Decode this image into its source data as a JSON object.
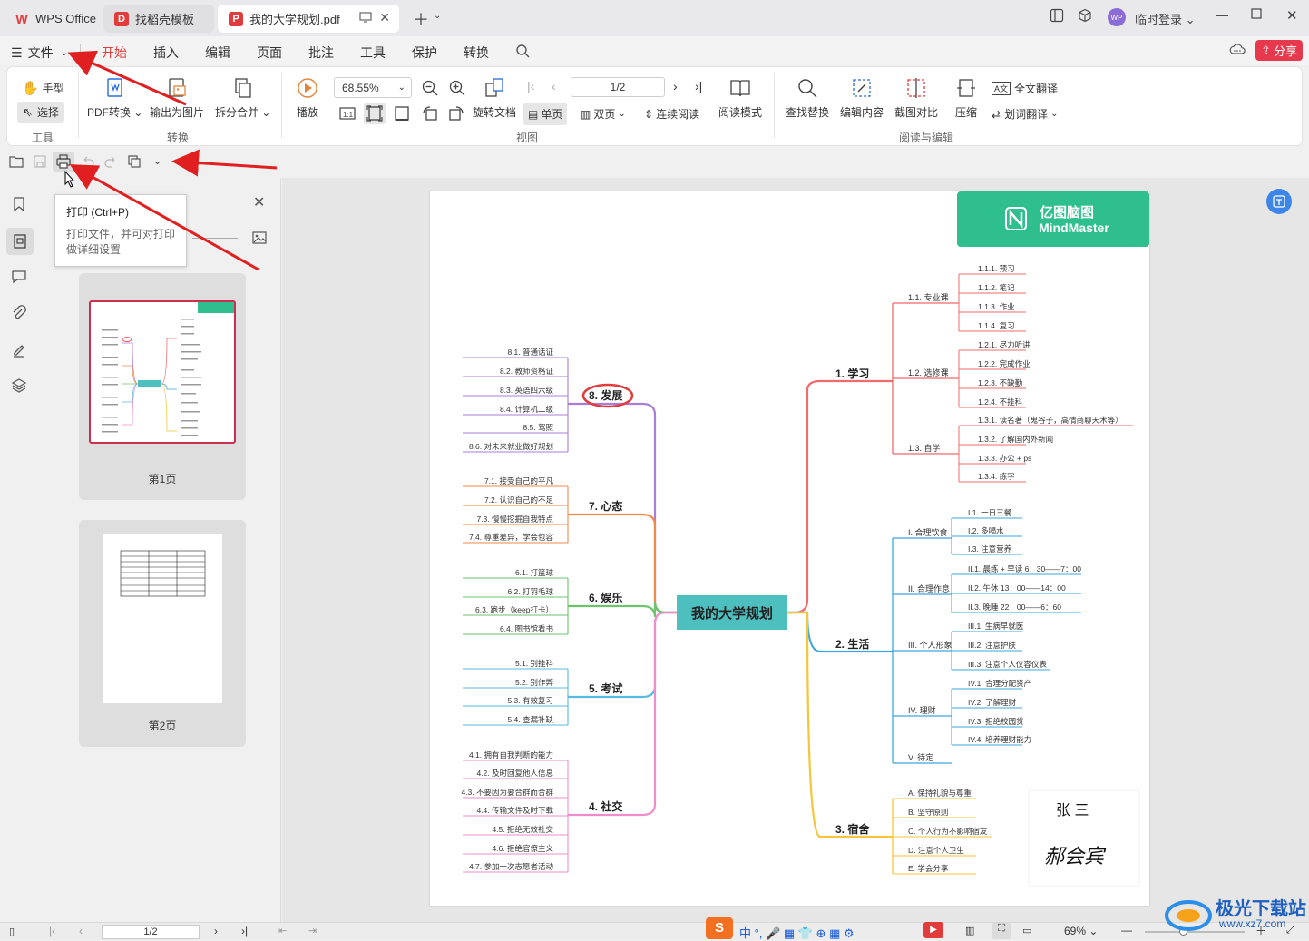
{
  "tabs": [
    {
      "label": "WPS Office"
    },
    {
      "label": "找稻壳模板"
    },
    {
      "label": "我的大学规划.pdf"
    }
  ],
  "account": {
    "label": "临时登录"
  },
  "avatar_text": "WP",
  "menu": {
    "file": "文件",
    "items": [
      "开始",
      "插入",
      "编辑",
      "页面",
      "批注",
      "工具",
      "保护",
      "转换"
    ],
    "share": "分享"
  },
  "ribbon": {
    "hand": "手型",
    "select": "选择",
    "tools_group": "工具",
    "pdf_convert": "PDF转换",
    "export_image": "输出为图片",
    "split_merge": "拆分合并",
    "convert_group": "转换",
    "play": "播放",
    "zoom": "68.55%",
    "page_input": "1/2",
    "rotate": "旋转文档",
    "single": "单页",
    "double": "双页",
    "continuous": "连续阅读",
    "read_mode": "阅读模式",
    "view_group": "视图",
    "find_replace": "查找替换",
    "edit_content": "编辑内容",
    "compare": "截图对比",
    "compress": "压缩",
    "full_translate": "全文翻译",
    "word_translate": "划词翻译",
    "read_edit_group": "阅读与编辑"
  },
  "tooltip": {
    "title": "打印 (Ctrl+P)",
    "body1": "打印文件，并可对打印",
    "body2": "做详细设置"
  },
  "thumbs": [
    {
      "label": "第1页"
    },
    {
      "label": "第2页"
    }
  ],
  "status": {
    "page": "1/2",
    "zoom": "69%"
  },
  "watermark": {
    "line1": "极光下载站",
    "line2": "www.xz7.com"
  },
  "mindmap": {
    "brand1": "亿图脑图",
    "brand2": "MindMaster",
    "center": "我的大学规划",
    "b1": {
      "title": "1. 学习",
      "subs": [
        {
          "name": "1.1. 专业课",
          "items": [
            "1.1.1. 预习",
            "1.1.2. 笔记",
            "1.1.3. 作业",
            "1.1.4. 复习"
          ]
        },
        {
          "name": "1.2. 选修课",
          "items": [
            "1.2.1. 尽力听讲",
            "1.2.2. 完成作业",
            "1.2.3. 不缺勤",
            "1.2.4. 不挂科"
          ]
        },
        {
          "name": "1.3. 自学",
          "items": [
            "1.3.1. 读名著（鬼谷子，高情商聊天术等）",
            "1.3.2. 了解国内外新闻",
            "1.3.3. 办公 + ps",
            "1.3.4. 练字"
          ]
        }
      ]
    },
    "b2": {
      "title": "2. 生活",
      "subs": [
        {
          "name": "I. 合理饮食",
          "items": [
            "I.1. 一日三餐",
            "I.2. 多喝水",
            "I.3. 注意营养"
          ]
        },
        {
          "name": "II. 合理作息",
          "items": [
            "II.1. 晨练 + 早读 6：30——7：00",
            "II.2. 午休  13：00——14：00",
            "II.3. 晚睡  22：00——6：60"
          ]
        },
        {
          "name": "III. 个人形象",
          "items": [
            "III.1. 生病早就医",
            "III.2. 注意护肤",
            "III.3. 注意个人仪容仪表"
          ]
        },
        {
          "name": "IV. 理财",
          "items": [
            "IV.1. 合理分配资产",
            "IV.2. 了解理财",
            "IV.3. 拒绝校园贷",
            "IV.4. 培养理财能力"
          ]
        },
        {
          "name": "V. 待定",
          "items": []
        }
      ]
    },
    "b3": {
      "title": "3. 宿舍",
      "items": [
        "A. 保持礼貌与尊重",
        "B. 坚守原则",
        "C. 个人行为不影响宿友",
        "D. 注意个人卫生",
        "E. 学会分享"
      ]
    },
    "b4": {
      "title": "4. 社交",
      "items": [
        "4.1. 拥有自我判断的能力",
        "4.2. 及时回复他人信息",
        "4.3. 不要因为要合群而合群",
        "4.4. 传输文件及时下载",
        "4.5. 拒绝无效社交",
        "4.6. 拒绝官僚主义",
        "4.7. 参加一次志愿者活动"
      ]
    },
    "b5": {
      "title": "5. 考试",
      "items": [
        "5.1. 别挂科",
        "5.2. 别作弊",
        "5.3. 有效复习",
        "5.4. 查漏补缺"
      ]
    },
    "b6": {
      "title": "6. 娱乐",
      "items": [
        "6.1. 打篮球",
        "6.2. 打羽毛球",
        "6.3. 跑步（keep打卡）",
        "6.4. 图书馆看书"
      ]
    },
    "b7": {
      "title": "7. 心态",
      "items": [
        "7.1. 接受自己的平凡",
        "7.2. 认识自己的不足",
        "7.3. 慢慢挖掘自我特点",
        "7.4. 尊重差异，学会包容"
      ]
    },
    "b8": {
      "title": "8. 发展",
      "items": [
        "8.1. 普通话证",
        "8.2. 教师资格证",
        "8.3. 英语四六级",
        "8.4. 计算机二级",
        "8.5. 驾照",
        "8.6. 对未来就业做好规划"
      ]
    },
    "sign_name": "张 三",
    "sign_script": "郝会宾"
  },
  "colors": {
    "accent": "#e23b3b",
    "b1": "#f06b6b",
    "b2": "#3ea7e0",
    "b3": "#f5c53a",
    "b4": "#f08ecb",
    "b5": "#5ab9e0",
    "b6": "#6cc36c",
    "b7": "#f08a4b",
    "b8": "#a77ed8",
    "center": "#4dbfbf"
  }
}
